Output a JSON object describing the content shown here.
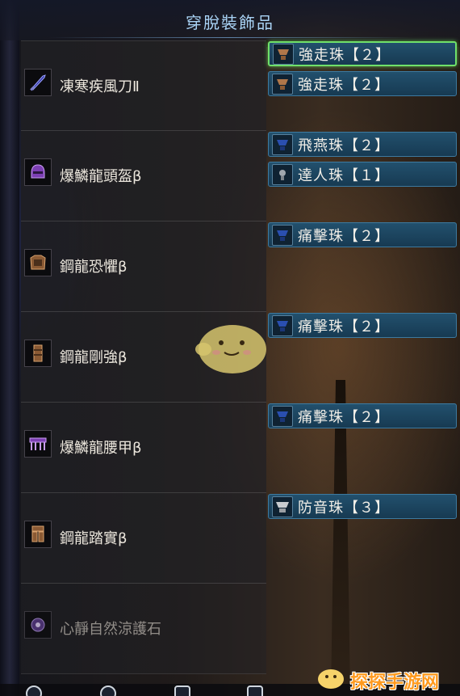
{
  "title": "穿脫裝飾品",
  "equipment": [
    {
      "name": "凍寒疾風刀Ⅱ",
      "icon": "great-sword-icon",
      "slots": [
        {
          "label": "強走珠【２】",
          "icon": "jewel-rank2-icon",
          "selected": true
        },
        {
          "label": "強走珠【２】",
          "icon": "jewel-rank2-icon",
          "selected": false
        }
      ]
    },
    {
      "name": "爆鱗龍頭盔β",
      "icon": "helmet-icon",
      "slots": [
        {
          "label": "飛燕珠【２】",
          "icon": "jewel-rank2-icon",
          "selected": false
        },
        {
          "label": "達人珠【１】",
          "icon": "jewel-rank1-icon",
          "selected": false
        }
      ]
    },
    {
      "name": "鋼龍恐懼β",
      "icon": "chest-armor-icon",
      "slots": [
        {
          "label": "痛擊珠【２】",
          "icon": "jewel-rank2-icon",
          "selected": false
        }
      ]
    },
    {
      "name": "鋼龍剛強β",
      "icon": "gauntlet-icon",
      "slots": [
        {
          "label": "痛擊珠【２】",
          "icon": "jewel-rank2-icon",
          "selected": false
        }
      ]
    },
    {
      "name": "爆鱗龍腰甲β",
      "icon": "waist-armor-icon",
      "slots": [
        {
          "label": "痛擊珠【２】",
          "icon": "jewel-rank2-icon",
          "selected": false
        }
      ]
    },
    {
      "name": "鋼龍踏實β",
      "icon": "leg-armor-icon",
      "slots": [
        {
          "label": "防音珠【３】",
          "icon": "jewel-rank3-icon",
          "selected": false
        }
      ]
    },
    {
      "name": "心靜自然涼護石",
      "icon": "charm-icon",
      "slots": []
    }
  ],
  "colors": {
    "title": "#a9d3f5",
    "slot_bg": "#1d4862",
    "slot_border": "#3d7aa0",
    "selected_border": "#6fe06a",
    "jewel_rank1": "#a0a6ad",
    "jewel_rank2": "#2a4fb0",
    "jewel_rank3": "#c9ccd0"
  },
  "watermark": "探探手游网"
}
